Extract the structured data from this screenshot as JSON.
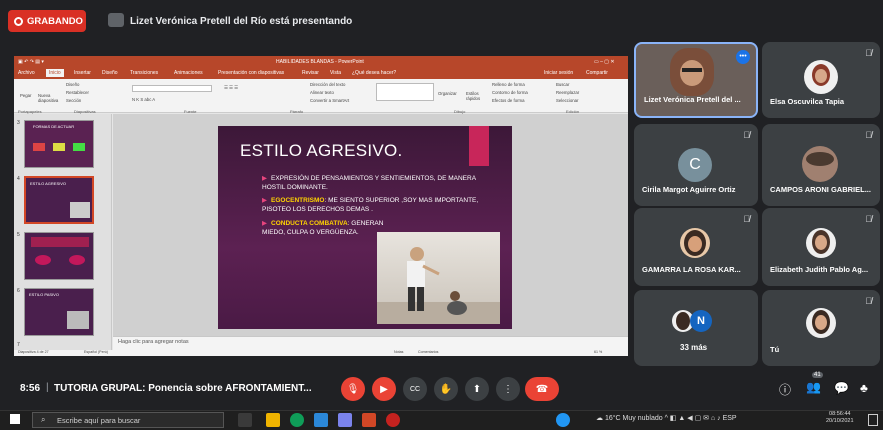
{
  "topbar": {
    "recording_label": "GRABANDO",
    "presenting_text": "Lizet Verónica Pretell del Río está presentando"
  },
  "powerpoint": {
    "window_title": "HABILIDADES BLANDAS - PowerPoint",
    "signin": "Iniciar sesión",
    "share": "Compartir",
    "tabs": [
      "Archivo",
      "Inicio",
      "Insertar",
      "Diseño",
      "Transiciones",
      "Animaciones",
      "Presentación con diapositivas",
      "Revisar",
      "Vista",
      "¿Qué desea hacer?"
    ],
    "ribbon": {
      "paste": "Pegar",
      "new_slide": "Nueva diapositiva",
      "layout": "Diseño",
      "reset": "Restablecer",
      "section": "Sección",
      "text_direction": "Dirección del texto",
      "align_text": "Alinear texto",
      "convert_smartart": "Convertir a SmartArt",
      "arrange": "Organizar",
      "quick_styles": "Estilos rápidos",
      "shape_fill": "Relleno de forma",
      "shape_outline": "Contorno de forma",
      "shape_effects": "Efectos de forma",
      "find": "Buscar",
      "replace": "Reemplazar",
      "select": "Seleccionar",
      "groups": [
        "Portapapeles",
        "Diapositivas",
        "Fuente",
        "Párrafo",
        "Dibujo",
        "Edición"
      ]
    },
    "thumbnails": [
      {
        "num": "3",
        "title": "FORMAS DE ACTUAR"
      },
      {
        "num": "4",
        "title": "ESTILO AGRESIVO"
      },
      {
        "num": "5",
        "title": ""
      },
      {
        "num": "6",
        "title": "ESTILO PASIVO"
      },
      {
        "num": "7",
        "title": ""
      }
    ],
    "slide": {
      "title": "ESTILO AGRESIVO.",
      "bullets": [
        {
          "lead": "",
          "text": "EXPRESIÓN DE PENSAMIENTOS Y SENTIEMIENTOS, DE MANERA HOSTIL DOMINANTE."
        },
        {
          "lead": "EGOCENTRISMO",
          "text": ": ME SIENTO SUPERIOR ,SOY MAS IMPORTANTE, PISOTEO LOS DERECHOS DEMAS ."
        },
        {
          "lead": "CONDUCTA COMBATIVA",
          "text": ": GENERAN MIEDO, CULPA O VERGÜENZA."
        }
      ]
    },
    "notes_placeholder": "Haga clic para agregar notas",
    "status_slide": "Diapositiva 4 de 27",
    "status_lang": "Español (Perú)",
    "status_notes": "Notas",
    "status_comments": "Comentarios",
    "zoom": "61 %"
  },
  "participants": [
    {
      "name": "Lizet Verónica Pretell del ...",
      "muted": false,
      "active_speaker": true
    },
    {
      "name": "Elsa Oscuvilca Tapia",
      "muted": true
    },
    {
      "name": "Cirila Margot Aguirre Ortiz",
      "muted": true,
      "initial": "C"
    },
    {
      "name": "CAMPOS ARONI GABRIEL...",
      "muted": true
    },
    {
      "name": "GAMARRA LA ROSA KAR...",
      "muted": true
    },
    {
      "name": "Elizabeth Judith Pablo Ag...",
      "muted": true
    },
    {
      "name": "33 más",
      "muted": false,
      "initial": "N"
    },
    {
      "name": "Tú",
      "muted": true
    }
  ],
  "bottom_bar": {
    "time": "8:56",
    "separator": "|",
    "meeting_title": "TUTORIA GRUPAL: Ponencia sobre AFRONTAMIENT...",
    "participant_count": "41"
  },
  "taskbar": {
    "search_placeholder": "Escribe aquí para buscar",
    "weather": "16°C  Muy nublado",
    "lang": "ESP",
    "clock_time": "08:56:44",
    "clock_date": "20/10/2021"
  },
  "colors": {
    "meet_bg": "#202124",
    "tile_bg": "#3c4043",
    "record_red": "#d93025",
    "ppt_red": "#b7472a",
    "end_call": "#ea4335"
  }
}
